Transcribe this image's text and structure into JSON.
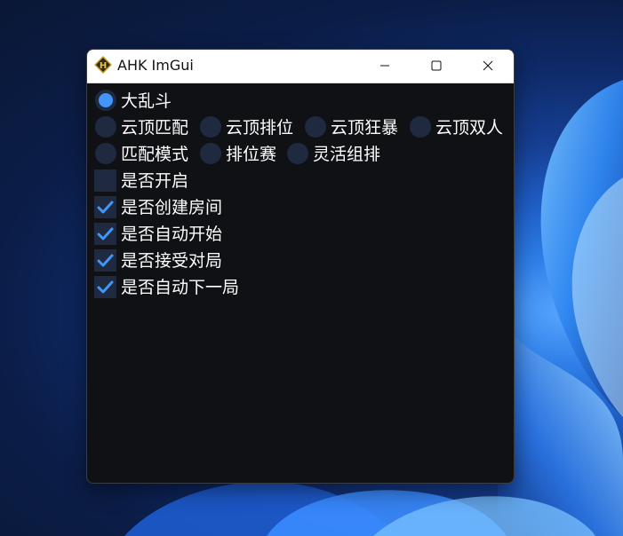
{
  "window": {
    "title": "AHK ImGui"
  },
  "colors": {
    "accent": "#4296fa",
    "widget_bg": "#1f2a40",
    "window_bg": "#0f1115",
    "text": "#ffffff"
  },
  "radio_groups": {
    "mode_main": {
      "label": "大乱斗",
      "checked": true
    },
    "tft": [
      {
        "label": "云顶匹配",
        "checked": false
      },
      {
        "label": "云顶排位",
        "checked": false
      },
      {
        "label": "云顶狂暴",
        "checked": false
      },
      {
        "label": "云顶双人",
        "checked": false
      }
    ],
    "queue": [
      {
        "label": "匹配模式",
        "checked": false
      },
      {
        "label": "排位赛",
        "checked": false
      },
      {
        "label": "灵活组排",
        "checked": false
      }
    ]
  },
  "checkboxes": [
    {
      "label": "是否开启",
      "checked": false
    },
    {
      "label": "是否创建房间",
      "checked": true
    },
    {
      "label": "是否自动开始",
      "checked": true
    },
    {
      "label": "是否接受对局",
      "checked": true
    },
    {
      "label": "是否自动下一局",
      "checked": true
    }
  ]
}
